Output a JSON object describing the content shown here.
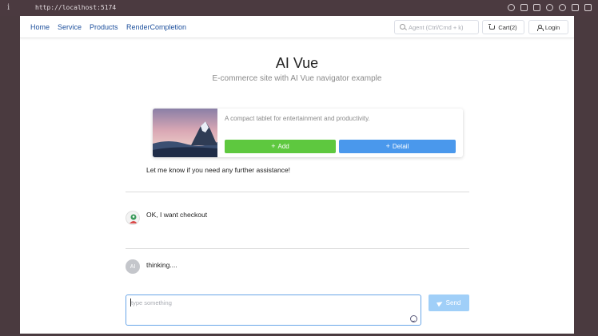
{
  "browser": {
    "url": "http://localhost:5174"
  },
  "nav": {
    "links": [
      "Home",
      "Service",
      "Products",
      "RenderCompletion"
    ],
    "search_placeholder": "Agent (Ctrl/Cmd + k)",
    "cart_label": "Cart(2)",
    "login_label": "Login"
  },
  "hero": {
    "title": "AI Vue",
    "subtitle": "E-commerce site with AI Vue navigator example"
  },
  "product": {
    "description": "A compact tablet for entertainment and productivity.",
    "add_label": "Add",
    "detail_label": "Detail"
  },
  "chat": {
    "assistant_message": "Let me know if you need any further assistance!",
    "user_message": "OK, I want checkout",
    "ai_avatar_label": "AI",
    "ai_status": "thinking....",
    "input_placeholder": "type something",
    "send_label": "Send"
  },
  "colors": {
    "nav_link": "#1c4f9c",
    "add_button": "#5ec83f",
    "detail_button": "#4a98ec",
    "send_button": "#a0cff8"
  }
}
